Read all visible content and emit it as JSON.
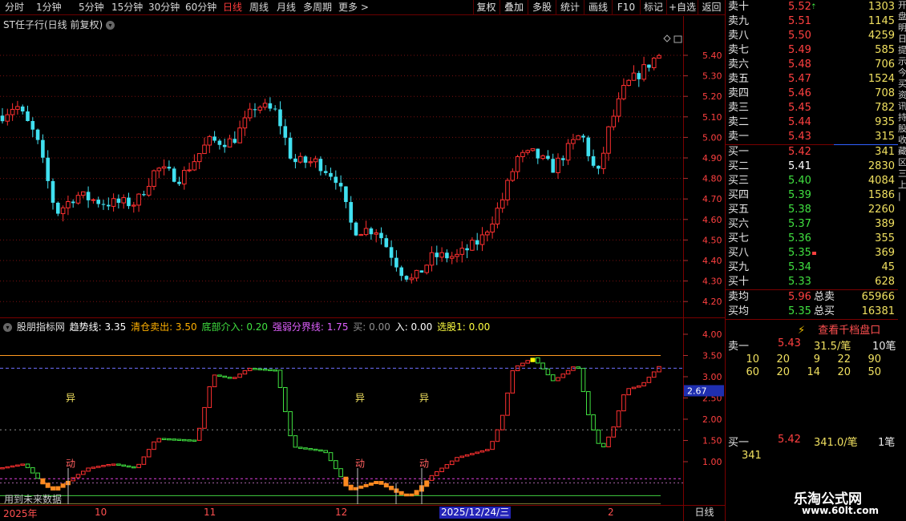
{
  "toolbar": {
    "periods": [
      "分时",
      "1分钟",
      "5分钟",
      "15分钟",
      "30分钟",
      "60分钟",
      "日线",
      "周线",
      "月线",
      "多周期",
      "更多"
    ],
    "active_period": "日线",
    "more_arrow": ">",
    "buttons": [
      "复权",
      "叠加",
      "多股",
      "统计",
      "画线",
      "F10",
      "标记",
      "+自选",
      "返回"
    ]
  },
  "main": {
    "title": "ST任子行(日线 前复权)",
    "price_axis": [
      "5.40",
      "5.30",
      "5.20",
      "5.10",
      "5.00",
      "4.90",
      "4.80",
      "4.70",
      "4.60",
      "4.50",
      "4.40",
      "4.30",
      "4.20"
    ]
  },
  "indicator": {
    "name": "股朋指标网",
    "items": [
      {
        "label": "趋势线:",
        "value": "3.35",
        "color": "#ffffff"
      },
      {
        "label": "清仓卖出:",
        "value": "3.50",
        "color": "#ffb000"
      },
      {
        "label": "底部介入:",
        "value": "0.20",
        "color": "#40e040"
      },
      {
        "label": "强弱分界线:",
        "value": "1.75",
        "color": "#e060ff"
      },
      {
        "label": "买:",
        "value": "0.00",
        "color": "#909090"
      },
      {
        "label": "入:",
        "value": "0.00",
        "color": "#ffffff"
      },
      {
        "label": "选股1:",
        "value": "0.00",
        "color": "#ffff40"
      }
    ],
    "axis": [
      "4.00",
      "3.50",
      "3.00",
      "2.50",
      "2.00",
      "1.50",
      "1.00"
    ],
    "current_value": "2.67",
    "marks": {
      "yi": "异",
      "dong": "动"
    },
    "future_note": "用到未来数据"
  },
  "datebar": {
    "labels": [
      "2025年",
      "10",
      "11",
      "12",
      "2"
    ],
    "cursor_date": "2025/12/24/三",
    "period": "日线"
  },
  "order_book": {
    "asks": [
      {
        "label": "卖十",
        "price": "5.52",
        "volume": "1303"
      },
      {
        "label": "卖九",
        "price": "5.51",
        "volume": "1145"
      },
      {
        "label": "卖八",
        "price": "5.50",
        "volume": "4259"
      },
      {
        "label": "卖七",
        "price": "5.49",
        "volume": "585"
      },
      {
        "label": "卖六",
        "price": "5.48",
        "volume": "706"
      },
      {
        "label": "卖五",
        "price": "5.47",
        "volume": "1524"
      },
      {
        "label": "卖四",
        "price": "5.46",
        "volume": "708"
      },
      {
        "label": "卖三",
        "price": "5.45",
        "volume": "782"
      },
      {
        "label": "卖二",
        "price": "5.44",
        "volume": "935"
      },
      {
        "label": "卖一",
        "price": "5.43",
        "volume": "315"
      }
    ],
    "bids": [
      {
        "label": "买一",
        "price": "5.42",
        "volume": "341",
        "color": "#ff4040"
      },
      {
        "label": "买二",
        "price": "5.41",
        "volume": "2830",
        "color": "#ffffff"
      },
      {
        "label": "买三",
        "price": "5.40",
        "volume": "4084",
        "color": "#40e040"
      },
      {
        "label": "买四",
        "price": "5.39",
        "volume": "1586",
        "color": "#40e040"
      },
      {
        "label": "买五",
        "price": "5.38",
        "volume": "2260",
        "color": "#40e040"
      },
      {
        "label": "买六",
        "price": "5.37",
        "volume": "389",
        "color": "#40e040"
      },
      {
        "label": "买七",
        "price": "5.36",
        "volume": "355",
        "color": "#40e040"
      },
      {
        "label": "买八",
        "price": "5.35",
        "volume": "369",
        "color": "#40e040"
      },
      {
        "label": "买九",
        "price": "5.34",
        "volume": "45",
        "color": "#40e040"
      },
      {
        "label": "买十",
        "price": "5.33",
        "volume": "628",
        "color": "#40e040"
      }
    ],
    "avg_sell": {
      "label": "卖均",
      "price": "5.96",
      "tlabel": "总卖",
      "total": "65966"
    },
    "avg_buy": {
      "label": "买均",
      "price": "5.35",
      "tlabel": "总买",
      "total": "16381"
    },
    "l2_button": "查看千档盘口",
    "sell_queue": {
      "label": "卖一",
      "price": "5.43",
      "avg": "31.5/笔",
      "count": "10笔",
      "orders": [
        "10",
        "20",
        "9",
        "22",
        "90",
        "60",
        "20",
        "14",
        "20",
        "50"
      ]
    },
    "buy_queue": {
      "label": "买一",
      "price": "5.42",
      "avg": "341.0/笔",
      "count": "1笔",
      "orders": [
        "341"
      ]
    }
  },
  "right_strip": [
    "开",
    "盘",
    "明",
    "日",
    "提",
    "示",
    "今",
    "买",
    "资",
    "讯",
    "持",
    "股",
    "收",
    "藏",
    "区",
    "三",
    "上",
    "|"
  ],
  "watermark": {
    "title": "乐淘公式网",
    "url": "www.60lt.com"
  }
}
